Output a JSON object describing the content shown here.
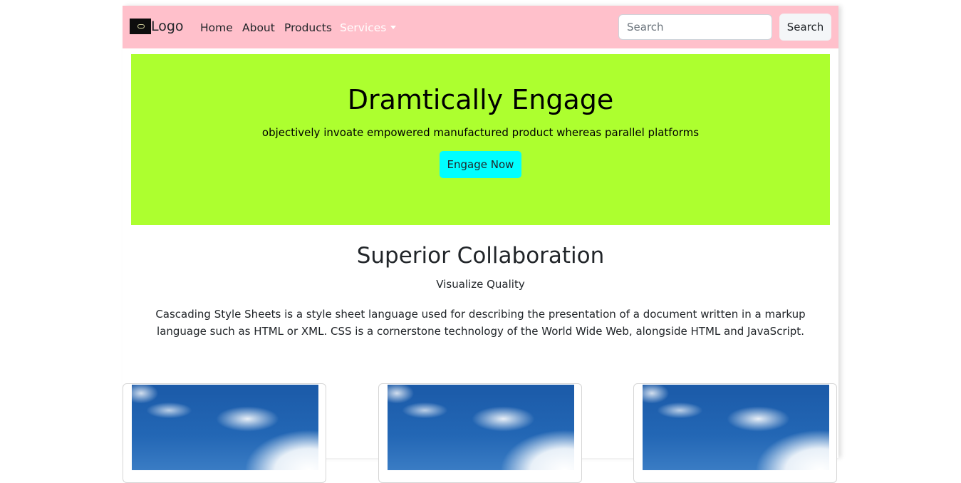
{
  "nav": {
    "brand_label": "Logo",
    "links": [
      "Home",
      "About",
      "Products"
    ],
    "services_label": "Services",
    "search_placeholder": "Search",
    "search_button": "Search"
  },
  "hero": {
    "title": "Dramtically Engage",
    "subtitle": "objectively invoate empowered manufactured product whereas parallel platforms",
    "button": "Engage Now",
    "background": "#adff2f",
    "button_color": "#00ffff"
  },
  "section": {
    "title": "Superior Collaboration",
    "subtitle": "Visualize Quality",
    "body": "Cascading Style Sheets is a style sheet language used for describing the presentation of a document written in a markup language such as HTML or XML. CSS is a cornerstone technology of the World Wide Web, alongside HTML and JavaScript."
  },
  "cards": [
    {
      "image": "sky-clouds-image"
    },
    {
      "image": "sky-clouds-image"
    },
    {
      "image": "sky-clouds-image"
    }
  ],
  "colors": {
    "navbar": "#ffc0cb"
  }
}
